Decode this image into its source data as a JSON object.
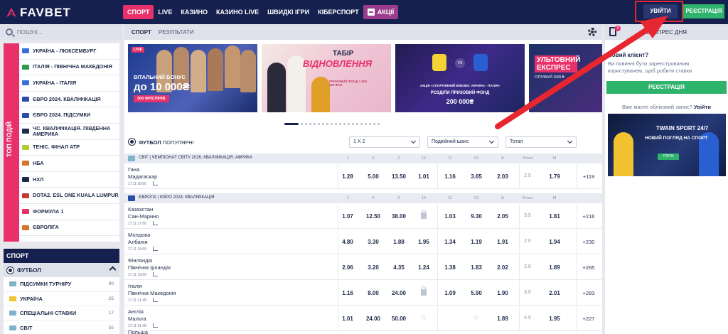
{
  "header": {
    "logo": "FAVBET",
    "nav": [
      "СПОРТ",
      "LIVE",
      "КАЗИНО",
      "КАЗИНО LIVE",
      "ШВИДКІ ІГРИ",
      "КІБЕРСПОРТ"
    ],
    "promo_label": "АКЦІЇ",
    "login_label": "УВІЙТИ",
    "register_label": "РЕЄСТРАЦІЯ"
  },
  "search": {
    "placeholder": "ПОШУК..."
  },
  "top_events": {
    "tab_label": "ТОП ПОДІЙ",
    "items": [
      {
        "label": "УКРАЇНА - ЛЮКСЕМБУРГ",
        "flag": "#3a6fd8"
      },
      {
        "label": "ІТАЛІЯ - ПІВНІЧНА МАКЕДОНІЯ",
        "flag": "#2e9b4f"
      },
      {
        "label": "УКРАЇНА - ІТАЛІЯ",
        "flag": "#3a6fd8"
      },
      {
        "label": "ЄВРО 2024. КВАЛІФІКАЦІЯ",
        "flag": "#2a4ea8"
      },
      {
        "label": "ЄВРО 2024. ПІДСУМКИ",
        "flag": "#2a4ea8"
      },
      {
        "label": "ЧС. КВАЛІФІКАЦІЯ. ПІВДЕННА АМЕРИКА",
        "flag": "#1e2a4a"
      },
      {
        "label": "ТЕНІС. ФІНАЛ ATP",
        "flag": "#b5c832"
      },
      {
        "label": "НБА",
        "flag": "#d9722b"
      },
      {
        "label": "НХЛ",
        "flag": "#1e2a4a"
      },
      {
        "label": "DOTA2. ESL ONE KUALA LUMPUR",
        "flag": "#c03a3a"
      },
      {
        "label": "ФОРМУЛА 1",
        "flag": "#e8316b"
      },
      {
        "label": "ЄВРОЛІГА",
        "flag": "#d9722b"
      }
    ]
  },
  "sport": {
    "header": "СПОРТ",
    "football_label": "ФУТБОЛ",
    "items": [
      {
        "label": "ПІДСУМКИ ТУРНІРУ",
        "count": "90",
        "flag": "#7fb3c9"
      },
      {
        "label": "УКРАЇНА",
        "count": "25",
        "flag": "#f2c230"
      },
      {
        "label": "СПЕЦІАЛЬНІ СТАВКИ",
        "count": "17",
        "flag": "#7fb3c9"
      },
      {
        "label": "СВІТ",
        "count": "55",
        "flag": "#7fb3c9"
      }
    ]
  },
  "center": {
    "tabs": [
      "СПОРТ",
      "РЕЗУЛЬТАТИ"
    ],
    "banners": {
      "b1_live": "LIVE",
      "b1_line1": "ВІТАЛЬНИЙ БОНУС",
      "b1_line2": "до 10 000₴",
      "b1_line3": "300 ФРІСПІНІВ",
      "b2_tab": "ТАБІР",
      "b2_title": "ВІДНОВЛЕННЯ",
      "b2_sub": "ПРИЗОВИЙ ФОНД 1 000 000 ₴АН",
      "b3_vs": "VS",
      "b3_line1": "АКЦІЯ «СПОРТИВНИЙ ВИКЛИК: УКРАЇНА - ІТАЛІЯ»",
      "b3_line2": "РОЗДІЛИ ПРИЗОВИЙ ФОНД",
      "b3_line3": "200 000₴",
      "b4_line1": "УЛЬТОВНИЙ ЕКСПРЕС",
      "b4_line2": "ОТРИМУЙ 1000 ₴"
    },
    "market": {
      "title_bold": "ФУТБОЛ",
      "title_rest": "ПОПУЛЯРНІ",
      "select1": "1 X 2",
      "select2": "Подвійний шанс",
      "select3": "Тотал"
    },
    "col_headers": [
      "1",
      "X",
      "2",
      "1X",
      "12",
      "X2",
      "Б",
      "Тотал",
      "М"
    ],
    "leagues": [
      {
        "name": "СВІТ | ЧЕМПІОНАТ СВІТУ 2026. КВАЛІФІКАЦІЯ. АФРИКА",
        "flag": "#7fb3c9"
      },
      {
        "name": "ЄВРОПА | ЄВРО 2024. КВАЛІФІКАЦІЯ",
        "flag": "#2a4ea8"
      }
    ],
    "matches": [
      {
        "team1": "Гана",
        "team2": "Мадагаскар",
        "time": "17.11 18:00",
        "odds": [
          "1.28",
          "5.00",
          "13.50",
          "1.01",
          "1.16",
          "3.65",
          "2.03",
          "2.5",
          "1.79"
        ],
        "more": "+119"
      },
      {
        "team1": "Казахстан",
        "team2": "Сан-Марино",
        "time": "17.11 17:00",
        "odds": [
          "1.07",
          "12.50",
          "38.00",
          "",
          "1.03",
          "9.30",
          "2.05",
          "3.5",
          "1.81"
        ],
        "more": "+216"
      },
      {
        "team1": "Молдова",
        "team2": "Албанія",
        "time": "17.11 19:00",
        "odds": [
          "4.80",
          "3.30",
          "1.88",
          "1.95",
          "1.34",
          "1.19",
          "1.91",
          "2.0",
          "1.94"
        ],
        "more": "+230"
      },
      {
        "team1": "Фінляндія",
        "team2": "Північна Ірландія",
        "time": "17.11 19:00",
        "odds": [
          "2.06",
          "3.20",
          "4.35",
          "1.24",
          "1.38",
          "1.83",
          "2.02",
          "2.0",
          "1.89"
        ],
        "more": "+265"
      },
      {
        "team1": "Італія",
        "team2": "Північна Македонія",
        "time": "17.11 21:45",
        "odds": [
          "1.16",
          "8.00",
          "24.00",
          "",
          "1.09",
          "5.90",
          "1.90",
          "3.0",
          "2.01"
        ],
        "more": "+283"
      },
      {
        "team1": "Англія",
        "team2": "Мальта",
        "time": "17.11 21:45",
        "odds": [
          "1.01",
          "24.00",
          "50.00",
          "",
          "",
          "",
          "1.89",
          "4.5",
          "1.95"
        ],
        "more": "+227"
      }
    ],
    "next_team": "Польща"
  },
  "right": {
    "title": "ЕКСПРЕС ДНЯ",
    "badge": "0",
    "new_client_title": "Новий клієнт?",
    "new_client_text": "Ви повинні бути зареєстрованим користувачем, щоб робити ставки",
    "register_label": "РЕЄСТРАЦІЯ",
    "have_account": "Вже маєте обліковий запис?",
    "login_link": "Увійти",
    "ad_brand": "TWAIN SPORT 24/7",
    "ad_sub": "НОВИЙ ПОГЛЯД НА СПОРТ",
    "ad_btn": "ГРАТИ"
  }
}
